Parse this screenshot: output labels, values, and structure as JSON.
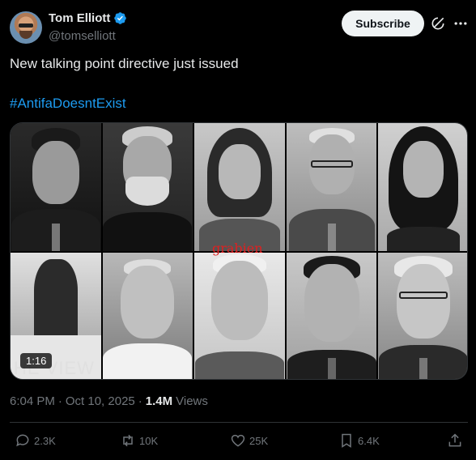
{
  "author": {
    "name": "Tom Elliott",
    "handle": "@tomselliott",
    "verified": true
  },
  "header": {
    "subscribe_label": "Subscribe",
    "grok_icon": "grok-icon",
    "more_icon": "more-icon"
  },
  "tweet": {
    "text": "New talking point directive just issued",
    "hashtag": "#AntifaDoesntExist"
  },
  "media": {
    "duration": "1:16",
    "watermark": "grabien",
    "show_logo": "HE VIEW"
  },
  "meta": {
    "time": "6:04 PM",
    "date": "Oct 10, 2025",
    "views_count": "1.4M",
    "views_label": "Views"
  },
  "actions": {
    "replies": "2.3K",
    "reposts": "10K",
    "likes": "25K",
    "bookmarks": "6.4K"
  },
  "colors": {
    "background": "#000000",
    "text": "#e7e9ea",
    "muted": "#71767b",
    "link": "#1d9bf0",
    "verified": "#1d9bf0",
    "subscribe_bg": "#eff3f4"
  }
}
